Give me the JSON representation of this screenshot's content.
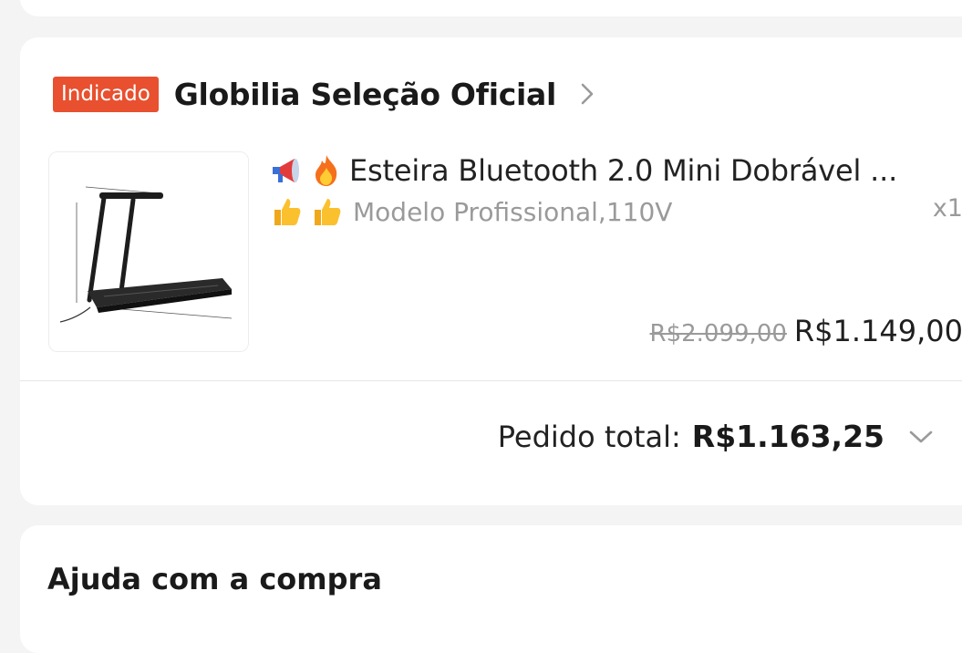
{
  "order": {
    "store_badge": "Indicado",
    "store_name": "Globilia Seleção Oficial",
    "item": {
      "title_emojis": [
        "megaphone-icon",
        "fire-icon"
      ],
      "title": "Esteira Bluetooth 2.0 Mini Dobrável ...",
      "variant_emojis": [
        "thumbs-up-icon",
        "thumbs-up-icon"
      ],
      "variant": "Modelo Profissional,110V",
      "quantity": "x1",
      "original_price": "R$2.099,00",
      "price": "R$1.149,00"
    },
    "total_label": "Pedido total:",
    "total_value": "R$1.163,25"
  },
  "help": {
    "title": "Ajuda com a compra"
  },
  "colors": {
    "badge": "#e8502f",
    "background": "#f4f4f4",
    "muted_text": "#9a9a9a"
  }
}
